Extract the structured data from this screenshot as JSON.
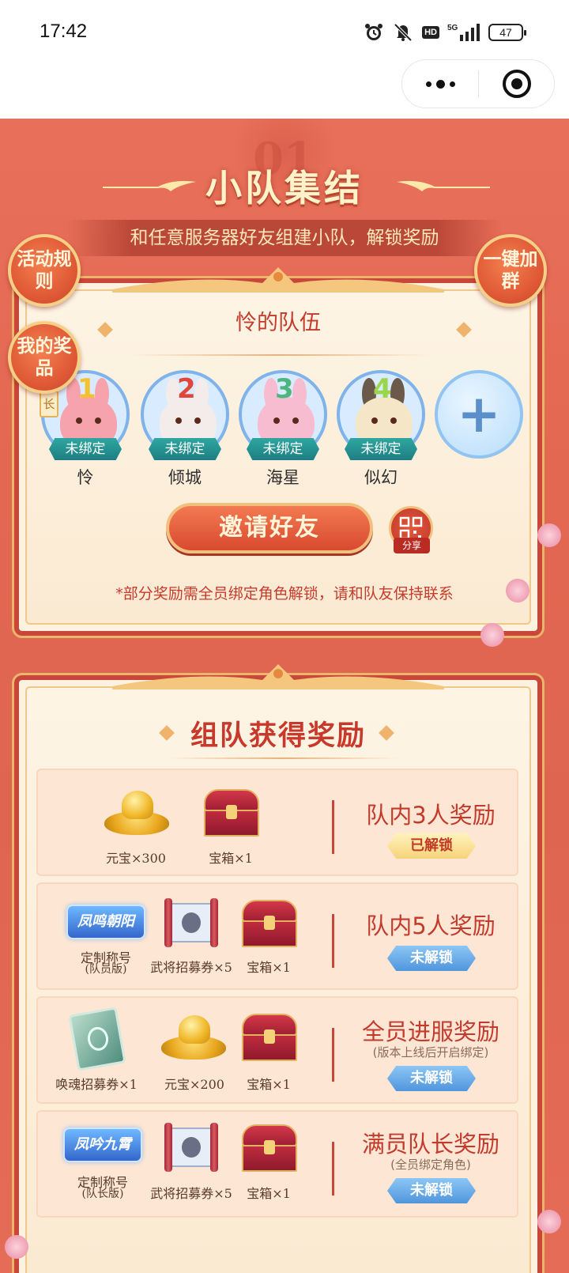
{
  "status_bar": {
    "time": "17:42",
    "network": "5G",
    "hd": "HD",
    "battery": "47"
  },
  "capsule": {
    "more_icon": "more-dots-icon",
    "close_icon": "target-close-icon"
  },
  "hero": {
    "bg_number": "01",
    "title": "小队集结",
    "subtitle": "和任意服务器好友组建小队，解锁奖励"
  },
  "side_buttons": {
    "rules": "活动规则",
    "join_group": "一键加群",
    "my_prizes": "我的奖品"
  },
  "team": {
    "title": "怜的队伍",
    "leader_tag": "长",
    "members": [
      {
        "name": "怜",
        "status": "未绑定",
        "num": "1",
        "color": "#f7a3ad"
      },
      {
        "name": "倾城",
        "status": "未绑定",
        "num": "2",
        "color": "#f3ecea"
      },
      {
        "name": "海星",
        "status": "未绑定",
        "num": "3",
        "color": "#f8bcd0"
      },
      {
        "name": "似幻",
        "status": "未绑定",
        "num": "4",
        "color": "#f6e6c8"
      }
    ],
    "add_label": "+",
    "invite_label": "邀请好友",
    "share_label": "分享",
    "notice": "*部分奖励需全员绑定角色解锁，请和队友保持联系"
  },
  "rewards": {
    "title": "组队获得奖励",
    "rows": [
      {
        "title": "队内3人奖励",
        "sub": "",
        "status": "已解锁",
        "status_kind": "unlocked",
        "items": [
          {
            "type": "ingot",
            "label": "元宝×300"
          },
          {
            "type": "chest",
            "label": "宝箱×1"
          }
        ]
      },
      {
        "title": "队内5人奖励",
        "sub": "",
        "status": "未解锁",
        "status_kind": "locked",
        "items": [
          {
            "type": "badge",
            "badge_text": "凤鸣朝阳",
            "label": "定制称号",
            "label2": "(队员版)"
          },
          {
            "type": "scroll",
            "label": "武将招募券×5"
          },
          {
            "type": "chest",
            "label": "宝箱×1"
          }
        ]
      },
      {
        "title": "全员进服奖励",
        "sub": "(版本上线后开启绑定)",
        "status": "未解锁",
        "status_kind": "locked",
        "items": [
          {
            "type": "card",
            "label": "唤魂招募券×1"
          },
          {
            "type": "ingot",
            "label": "元宝×200"
          },
          {
            "type": "chest",
            "label": "宝箱×1"
          }
        ]
      },
      {
        "title": "满员队长奖励",
        "sub": "(全员绑定角色)",
        "status": "未解锁",
        "status_kind": "locked",
        "items": [
          {
            "type": "badge",
            "badge_text": "凤吟九霄",
            "label": "定制称号",
            "label2": "(队长版)"
          },
          {
            "type": "scroll",
            "label": "武将招募券×5"
          },
          {
            "type": "chest",
            "label": "宝箱×1"
          }
        ]
      }
    ]
  },
  "colors": {
    "primary_red": "#c43a2c",
    "bg_coral": "#e36852",
    "gold": "#f2c07e",
    "locked_blue": "#5096dd",
    "unbound_teal": "#1e7e84"
  }
}
